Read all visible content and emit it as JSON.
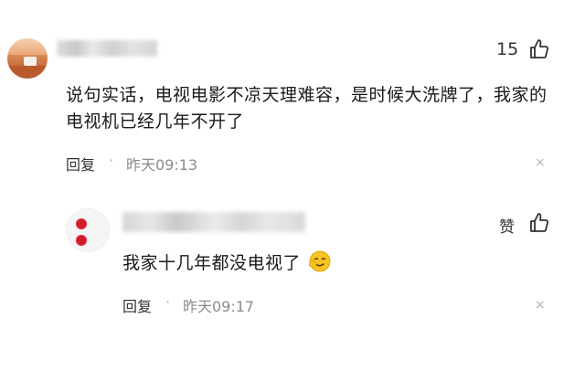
{
  "comments": [
    {
      "likes": "15",
      "text": "说句实话，电视电影不凉天理难容，是时候大洗牌了，我家的电视机已经几年不开了",
      "reply_label": "回复",
      "separator": "·",
      "time": "昨天09:13",
      "close_icon": "×"
    }
  ],
  "reply": {
    "like_label": "赞",
    "text": "我家十几年都没电视了",
    "reply_label": "回复",
    "separator": "·",
    "time": "昨天09:17",
    "close_icon": "×"
  },
  "colors": {
    "text": "#1a1a1a",
    "meta": "#8c8c8c",
    "heart": "#d11a2a"
  }
}
